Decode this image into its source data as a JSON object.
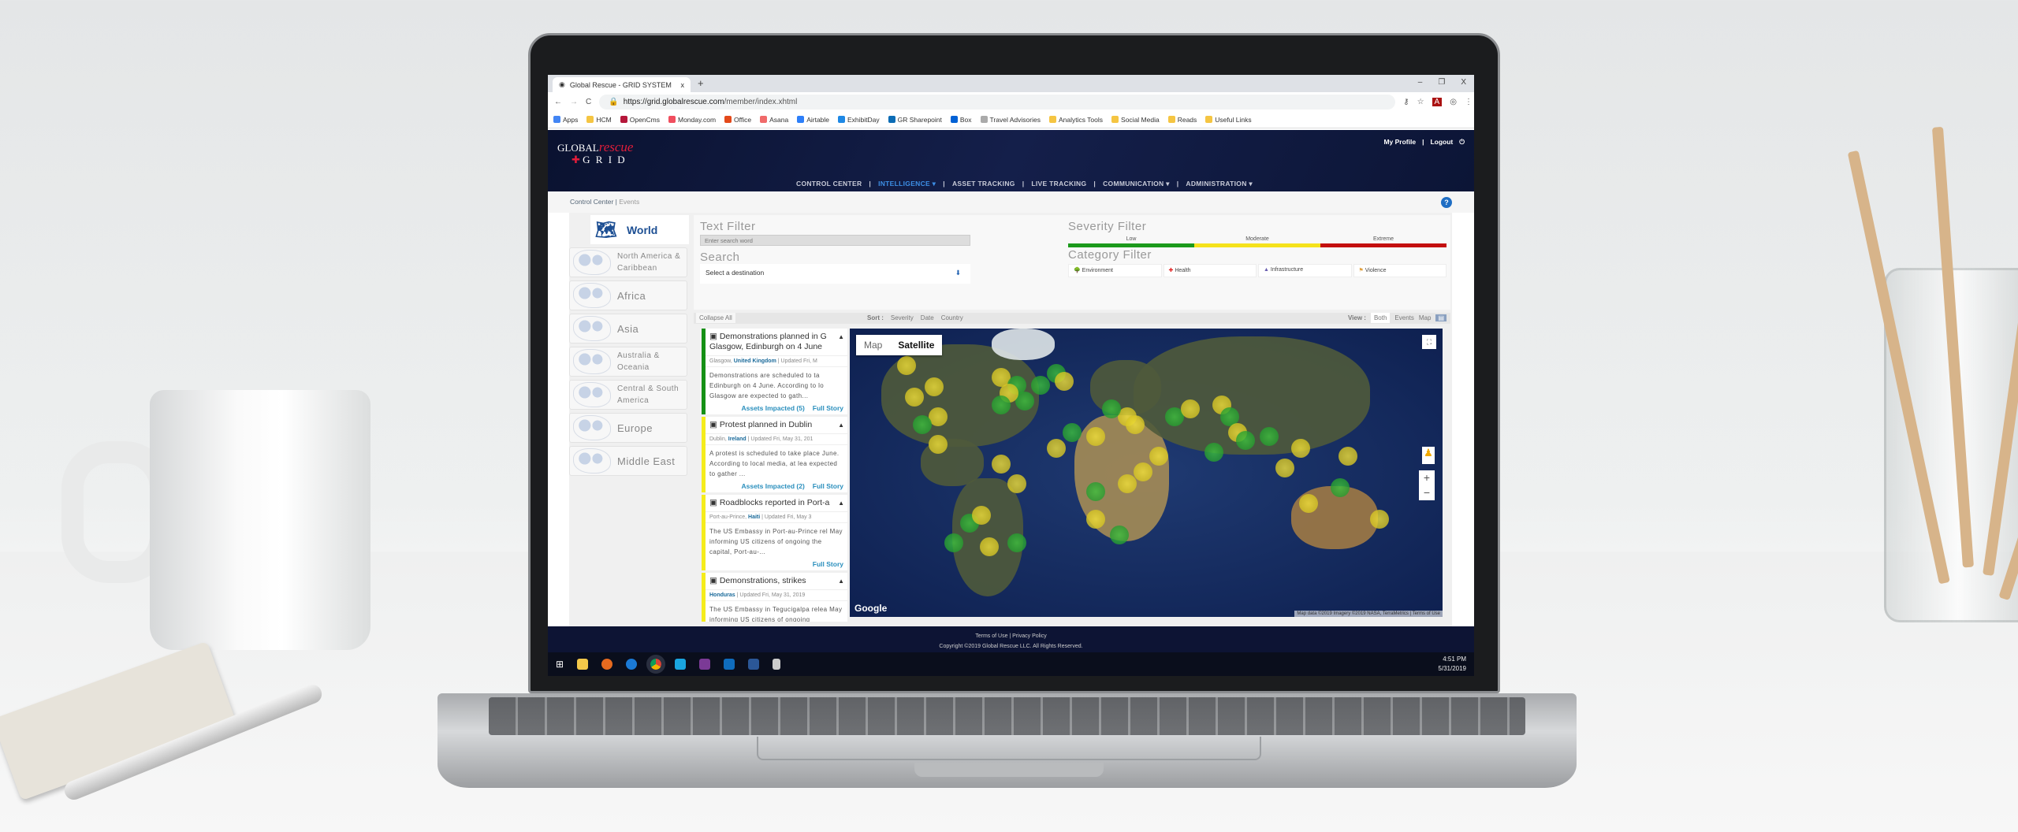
{
  "browser": {
    "tab_title": "Global Rescue - GRID SYSTEM",
    "tab_close": "x",
    "new_tab": "+",
    "window_controls": [
      "–",
      "❐",
      "X"
    ],
    "url_host": "https://grid.globalrescue.com",
    "url_path": "/member/index.xhtml",
    "bookmarks": [
      {
        "label": "Apps",
        "color": "#4285f4"
      },
      {
        "label": "HCM",
        "color": "#f5c542"
      },
      {
        "label": "OpenCms",
        "color": "#b5173a"
      },
      {
        "label": "Monday.com",
        "color": "#f04e5e"
      },
      {
        "label": "Office",
        "color": "#e3491a"
      },
      {
        "label": "Asana",
        "color": "#f06a6a"
      },
      {
        "label": "Airtable",
        "color": "#2d7ff9"
      },
      {
        "label": "ExhibitDay",
        "color": "#1e88e5"
      },
      {
        "label": "GR Sharepoint",
        "color": "#0b6cb5"
      },
      {
        "label": "Box",
        "color": "#0061d5"
      },
      {
        "label": "Travel Advisories",
        "color": "#aaaaaa"
      },
      {
        "label": "Analytics Tools",
        "color": "#f5c542"
      },
      {
        "label": "Social Media",
        "color": "#f5c542"
      },
      {
        "label": "Reads",
        "color": "#f5c542"
      },
      {
        "label": "Useful Links",
        "color": "#f5c542"
      }
    ]
  },
  "header": {
    "logo_global": "GLOBAL",
    "logo_rescue": "rescue",
    "logo_grid": "G R I D",
    "my_profile": "My Profile",
    "logout": "Logout",
    "nav": [
      "CONTROL CENTER",
      "INTELLIGENCE ▾",
      "ASSET TRACKING",
      "LIVE TRACKING",
      "COMMUNICATION ▾",
      "ADMINISTRATION ▾"
    ],
    "active_nav": "INTELLIGENCE ▾"
  },
  "breadcrumb": {
    "root": "Control Center",
    "current": "Events",
    "help": "?"
  },
  "regions": {
    "world": "World",
    "items": [
      "North America & Caribbean",
      "Africa",
      "Asia",
      "Australia & Oceania",
      "Central & South America",
      "Europe",
      "Middle East"
    ]
  },
  "filters": {
    "text_filter_label": "Text Filter",
    "text_filter_placeholder": "Enter search word",
    "search_label": "Search",
    "search_value": "Select a destination",
    "severity_label": "Severity Filter",
    "severity": [
      {
        "label": "Low",
        "color": "#1c9a1c"
      },
      {
        "label": "Moderate",
        "color": "#f5e21c"
      },
      {
        "label": "Extreme",
        "color": "#c40f0f"
      }
    ],
    "category_label": "Category Filter",
    "categories": [
      {
        "label": "Environment",
        "icon": "🌳"
      },
      {
        "label": "Health",
        "icon": "✚"
      },
      {
        "label": "Infrastructure",
        "icon": "▲"
      },
      {
        "label": "Violence",
        "icon": "⚑"
      }
    ]
  },
  "toolbar": {
    "collapse_all": "Collapse All",
    "sort_label": "Sort :",
    "sort_options": [
      "Severity",
      "Date",
      "Country"
    ],
    "view_label": "View :",
    "view_options": [
      "Both",
      "Events",
      "Map"
    ],
    "active_view": "Both"
  },
  "events": [
    {
      "title": "Demonstrations planned in G Glasgow, Edinburgh on 4 June",
      "city": "Glasgow,",
      "country": "United Kingdom",
      "updated": "| Updated Fri, M",
      "desc": "Demonstrations are scheduled to ta Edinburgh on 4 June. According to lo Glasgow are expected to gath...",
      "assets": "Assets Impacted (5)",
      "full": "Full Story",
      "severity_color": "#159015"
    },
    {
      "title": "Protest planned in Dublin",
      "city": "Dublin,",
      "country": "Ireland",
      "updated": "| Updated Fri, May 31, 201",
      "desc": "A protest is scheduled to take place June. According to local media, at lea expected to gather ...",
      "assets": "Assets Impacted (2)",
      "full": "Full Story",
      "severity_color": "#f5ec1c"
    },
    {
      "title": "Roadblocks reported in Port-a",
      "city": "Port-au-Prince,",
      "country": "Haiti",
      "updated": "| Updated Fri, May 3",
      "desc": "The US Embassy in Port-au-Prince rel May informing US citizens of ongoing the capital, Port-au-...",
      "assets": "",
      "full": "Full Story",
      "severity_color": "#f5ec1c"
    },
    {
      "title": "Demonstrations, strikes",
      "city": "",
      "country": "Honduras",
      "updated": "| Updated Fri, May 31, 2019",
      "desc": "The US Embassy in Tegucigalpa relea May informing US citizens of ongoing",
      "assets": "",
      "full": "",
      "severity_color": "#f5ec1c"
    }
  ],
  "map": {
    "type_options": [
      "Map",
      "Satellite"
    ],
    "active_type": "Satellite",
    "google": "Google",
    "attribution": "Map data ©2019 Imagery ©2019 NASA, TerraMetrics | Terms of Use",
    "zoom_in": "+",
    "zoom_out": "−",
    "fullscreen": "⛶"
  },
  "footer": {
    "links": "Terms of Use | Privacy Policy",
    "copyright": "Copyright ©2019 Global Rescue LLC. All Rights Reserved."
  },
  "taskbar": {
    "time": "4:51 PM",
    "date": "5/31/2019"
  }
}
